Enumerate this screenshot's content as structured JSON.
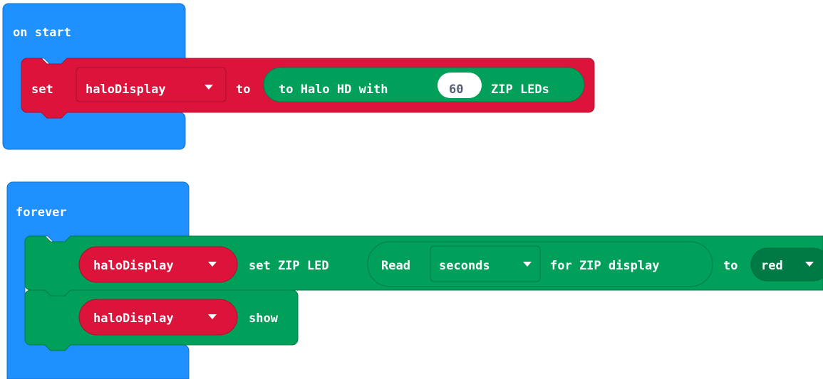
{
  "on_start": {
    "hat_label": "on start",
    "set_block": {
      "keyword": "set",
      "variable": "haloDisplay",
      "to_label": "to",
      "value_block": {
        "prefix": "to Halo HD with",
        "number": "60",
        "suffix": "ZIP LEDs"
      }
    }
  },
  "forever": {
    "hat_label": "forever",
    "set_zip_block": {
      "variable": "haloDisplay",
      "label": "set ZIP LED",
      "read_block": {
        "read_label": "Read",
        "unit": "seconds",
        "for_label": "for ZIP display"
      },
      "to_label": "to",
      "color": "red"
    },
    "show_block": {
      "variable": "haloDisplay",
      "label": "show"
    }
  },
  "colors": {
    "event_blue": "#1e90ff",
    "variable_red": "#dc143c",
    "zip_green": "#00a05a",
    "zip_green_dark": "#007a45",
    "stroke_dark": "#1a6fc2"
  },
  "icons": {
    "dropdown": "caret-down-icon"
  }
}
